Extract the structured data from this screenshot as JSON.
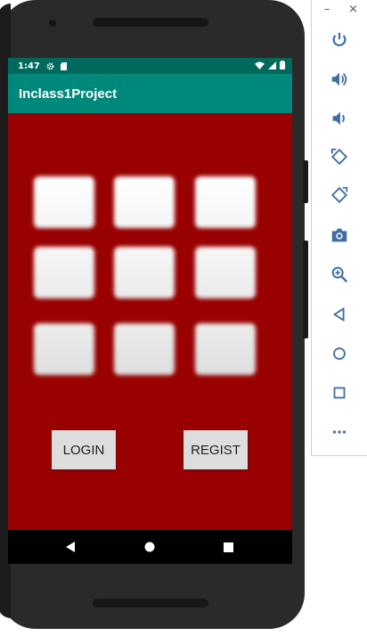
{
  "colors": {
    "status_bar": "#00695c",
    "app_bar": "#00897b",
    "screen_background": "#990000",
    "button": "#dddddd",
    "nav_bar": "#000000"
  },
  "emulator": {
    "window_controls": [
      "–",
      "×"
    ],
    "toolbar": [
      "power-icon",
      "volume-up-icon",
      "volume-down-icon",
      "rotate-left-icon",
      "rotate-right-icon",
      "camera-icon",
      "zoom-icon",
      "back-icon",
      "home-icon",
      "overview-icon",
      "more-icon"
    ]
  },
  "status_bar": {
    "time": "1:47",
    "icons": [
      "settings-icon",
      "sd-card-icon",
      "wifi-icon",
      "signal-icon",
      "battery-icon"
    ]
  },
  "app_bar": {
    "title": "Inclass1Project"
  },
  "grid": {
    "rows": 3,
    "cols": 3
  },
  "buttons": {
    "login": "LOGIN",
    "register": "REGIST"
  },
  "nav_bar": {
    "icons": [
      "back-icon",
      "home-icon",
      "overview-icon"
    ]
  }
}
